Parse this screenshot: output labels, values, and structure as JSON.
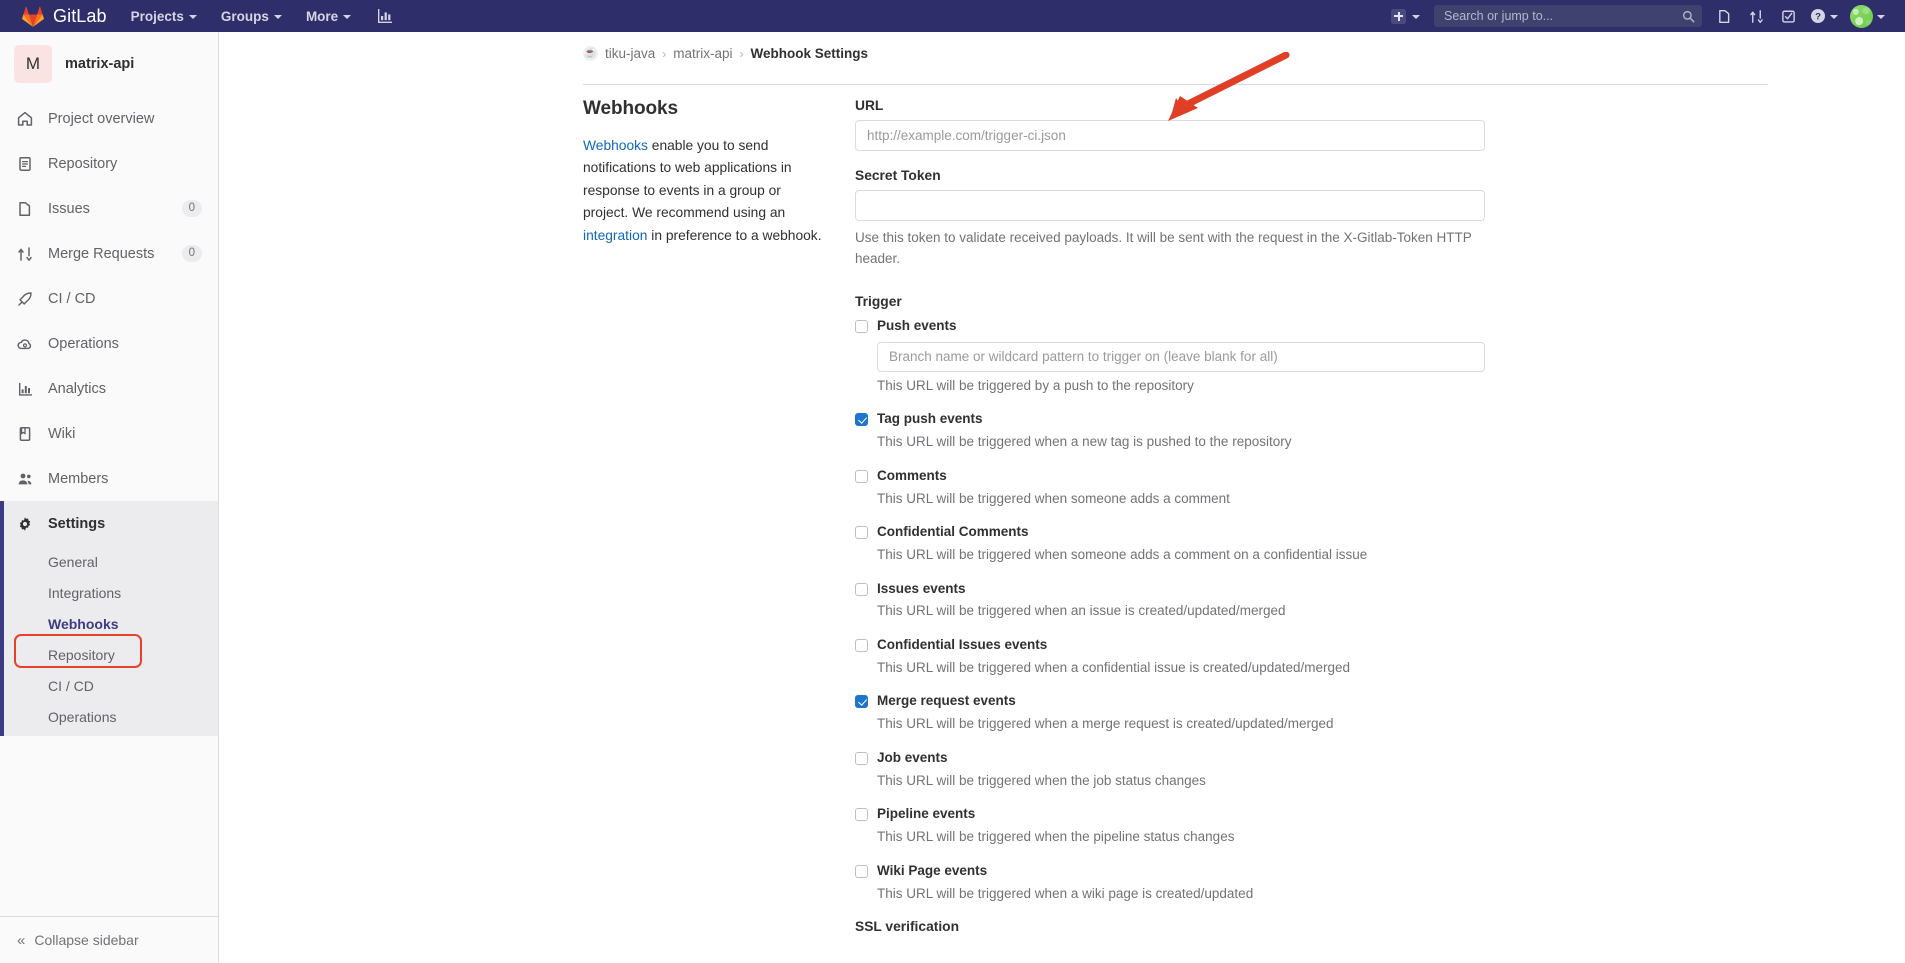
{
  "topnav": {
    "brand": "GitLab",
    "menu": [
      {
        "label": "Projects",
        "name": "projects"
      },
      {
        "label": "Groups",
        "name": "groups"
      },
      {
        "label": "More",
        "name": "more"
      }
    ],
    "analytics_icon": "chart-bar-icon",
    "create_new_icon": "plus-square-icon",
    "search": {
      "placeholder": "Search or jump to...",
      "value": "",
      "icon": "search-icon"
    },
    "icons": [
      {
        "name": "issues-icon",
        "title": "Issues"
      },
      {
        "name": "merge-requests-icon",
        "title": "Merge requests"
      },
      {
        "name": "todos-icon",
        "title": "To-Do List"
      },
      {
        "name": "help-icon",
        "title": "Help"
      }
    ],
    "avatar": {
      "name": "user-avatar",
      "color": "#8fdc6e"
    }
  },
  "sidebar": {
    "project": {
      "initial": "M",
      "name": "matrix-api",
      "avatar_color": "#fae3e3"
    },
    "items": [
      {
        "label": "Project overview",
        "icon": "home-icon",
        "badge": null,
        "active": false
      },
      {
        "label": "Repository",
        "icon": "document-icon",
        "badge": null,
        "active": false
      },
      {
        "label": "Issues",
        "icon": "issues-icon",
        "badge": "0",
        "active": false
      },
      {
        "label": "Merge Requests",
        "icon": "merge-requests-icon",
        "badge": "0",
        "active": false
      },
      {
        "label": "CI / CD",
        "icon": "rocket-icon",
        "badge": null,
        "active": false
      },
      {
        "label": "Operations",
        "icon": "cloud-gear-icon",
        "badge": null,
        "active": false
      },
      {
        "label": "Analytics",
        "icon": "chart-bar-icon",
        "badge": null,
        "active": false
      },
      {
        "label": "Wiki",
        "icon": "book-icon",
        "badge": null,
        "active": false
      },
      {
        "label": "Members",
        "icon": "users-icon",
        "badge": null,
        "active": false
      },
      {
        "label": "Settings",
        "icon": "gear-icon",
        "badge": null,
        "active": true
      }
    ],
    "settings_sub": [
      {
        "label": "General",
        "current": false
      },
      {
        "label": "Integrations",
        "current": false
      },
      {
        "label": "Webhooks",
        "current": true
      },
      {
        "label": "Repository",
        "current": false
      },
      {
        "label": "CI / CD",
        "current": false
      },
      {
        "label": "Operations",
        "current": false
      }
    ],
    "collapse": {
      "label": "Collapse sidebar",
      "icon": "double-chevron-left-icon"
    },
    "highlight_color": "#e8412b"
  },
  "breadcrumb": {
    "project_icon": "java-coffee-icon",
    "items": [
      {
        "label": "tiku-java",
        "current": false
      },
      {
        "label": "matrix-api",
        "current": false
      },
      {
        "label": "Webhook Settings",
        "current": true
      }
    ],
    "separator": "›"
  },
  "main": {
    "heading": "Webhooks",
    "description": {
      "link1": "Webhooks",
      "text1": " enable you to send notifications to web applications in response to events in a group or project. We recommend using an ",
      "link2": "integration",
      "text2": " in preference to a webhook."
    },
    "url_field": {
      "label": "URL",
      "placeholder": "http://example.com/trigger-ci.json",
      "value": ""
    },
    "secret_field": {
      "label": "Secret Token",
      "placeholder": "",
      "value": "",
      "help": "Use this token to validate received payloads. It will be sent with the request in the X-Gitlab-Token HTTP header."
    },
    "trigger_title": "Trigger",
    "triggers": [
      {
        "label": "Push events",
        "checked": false,
        "sub": "This URL will be triggered by a push to the repository",
        "input_placeholder": "Branch name or wildcard pattern to trigger on (leave blank for all)",
        "input_value": ""
      },
      {
        "label": "Tag push events",
        "checked": true,
        "sub": "This URL will be triggered when a new tag is pushed to the repository"
      },
      {
        "label": "Comments",
        "checked": false,
        "sub": "This URL will be triggered when someone adds a comment"
      },
      {
        "label": "Confidential Comments",
        "checked": false,
        "sub": "This URL will be triggered when someone adds a comment on a confidential issue"
      },
      {
        "label": "Issues events",
        "checked": false,
        "sub": "This URL will be triggered when an issue is created/updated/merged"
      },
      {
        "label": "Confidential Issues events",
        "checked": false,
        "sub": "This URL will be triggered when a confidential issue is created/updated/merged"
      },
      {
        "label": "Merge request events",
        "checked": true,
        "sub": "This URL will be triggered when a merge request is created/updated/merged"
      },
      {
        "label": "Job events",
        "checked": false,
        "sub": "This URL will be triggered when the job status changes"
      },
      {
        "label": "Pipeline events",
        "checked": false,
        "sub": "This URL will be triggered when the pipeline status changes"
      },
      {
        "label": "Wiki Page events",
        "checked": false,
        "sub": "This URL will be triggered when a wiki page is created/updated"
      }
    ],
    "ssl_title": "SSL verification"
  },
  "annotation": {
    "arrow_color": "#e03e25",
    "points_to": "url-input"
  }
}
